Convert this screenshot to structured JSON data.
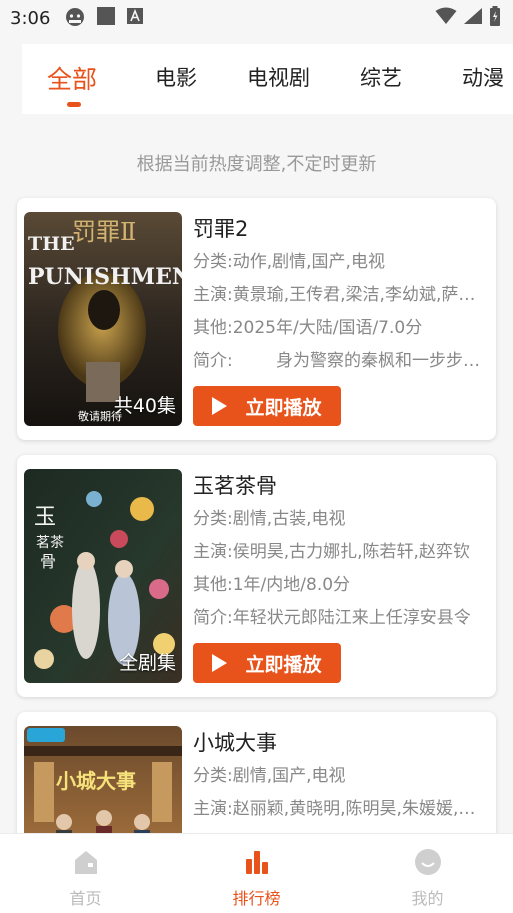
{
  "status_bar": {
    "time": "3:06"
  },
  "tabs": [
    {
      "label": "全部",
      "active": true
    },
    {
      "label": "电影",
      "active": false
    },
    {
      "label": "电视剧",
      "active": false
    },
    {
      "label": "综艺",
      "active": false
    },
    {
      "label": "动漫",
      "active": false
    }
  ],
  "hint": "根据当前热度调整,不定时更新",
  "cards": [
    {
      "title": "罚罪2",
      "category": "分类:动作,剧情,国产,电视",
      "cast": "主演:黄景瑜,王传君,梁洁,李幼斌,萨日娜",
      "other": "其他:2025年/大陆/国语/7.0分",
      "intro": "简介:        身为警察的秦枫和一步步追查",
      "poster_badge": "共40集",
      "poster_note": "敬请期待",
      "play_label": "立即播放"
    },
    {
      "title": "玉茗茶骨",
      "category": "分类:剧情,古装,电视",
      "cast": "主演:侯明昊,古力娜扎,陈若轩,赵弈钦",
      "other": "其他:1年/内地/8.0分",
      "intro": "简介:年轻状元郎陆江来上任淳安县令",
      "poster_badge": "全剧集",
      "play_label": "立即播放"
    },
    {
      "title": "小城大事",
      "category": "分类:剧情,国产,电视",
      "cast": "主演:赵丽颖,黄晓明,陈明昊,朱媛媛,胡军",
      "poster_badge": "",
      "play_label": "立即播放"
    }
  ],
  "bottom_nav": [
    {
      "label": "首页",
      "icon": "home-icon",
      "active": false
    },
    {
      "label": "排行榜",
      "icon": "ranking-icon",
      "active": true
    },
    {
      "label": "我的",
      "icon": "profile-icon",
      "active": false
    }
  ],
  "colors": {
    "accent": "#e8531c",
    "muted": "#888888",
    "background": "#f6f6f6"
  }
}
